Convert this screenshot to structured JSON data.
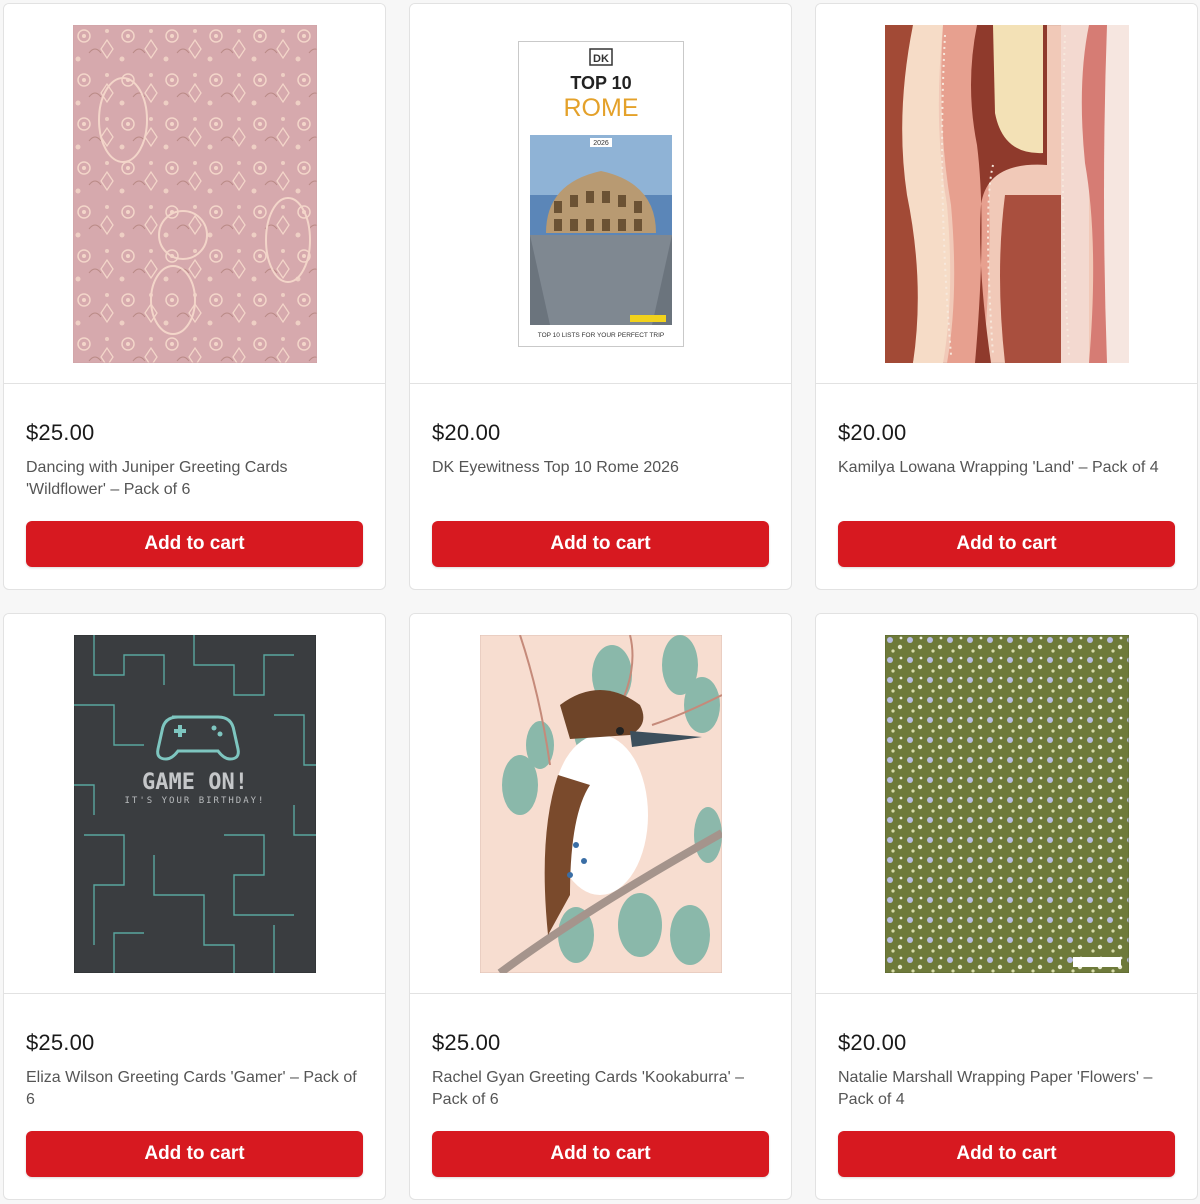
{
  "products": [
    {
      "price": "$25.00",
      "title": "Dancing with Juniper Greeting Cards 'Wildflower' – Pack of 6",
      "button": "Add to cart"
    },
    {
      "price": "$20.00",
      "title": "DK Eyewitness Top 10 Rome 2026",
      "button": "Add to cart",
      "cover": {
        "publisher": "DK",
        "line1": "TOP 10",
        "line2": "ROME",
        "year": "2026",
        "tagline": "TOP 10 LISTS FOR YOUR PERFECT TRIP"
      }
    },
    {
      "price": "$20.00",
      "title": "Kamilya Lowana Wrapping 'Land' – Pack of 4",
      "button": "Add to cart"
    },
    {
      "price": "$25.00",
      "title": "Eliza Wilson Greeting Cards 'Gamer' – Pack of 6",
      "button": "Add to cart",
      "cover": {
        "headline": "GAME ON!",
        "subline": "IT'S YOUR BIRTHDAY!"
      }
    },
    {
      "price": "$25.00",
      "title": "Rachel Gyan Greeting Cards 'Kookaburra' – Pack of 6",
      "button": "Add to cart"
    },
    {
      "price": "$20.00",
      "title": "Natalie Marshall Wrapping Paper 'Flowers' – Pack of 4",
      "button": "Add to cart"
    }
  ],
  "colors": {
    "accent": "#d71920",
    "price": "#1a1a1a",
    "title": "#555555"
  }
}
